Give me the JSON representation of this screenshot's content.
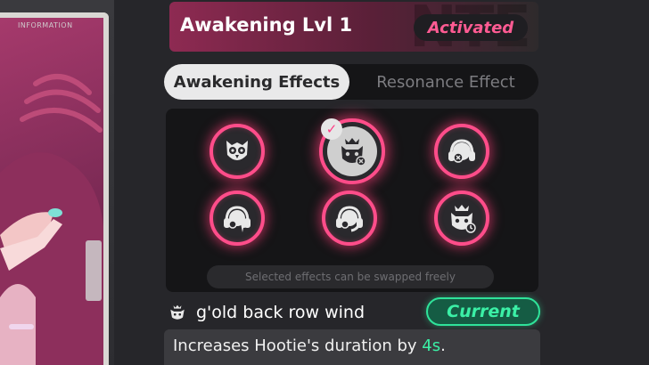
{
  "left_card": {
    "caption": "INFORMATION"
  },
  "header": {
    "title": "Awakening Lvl 1",
    "status": "Activated",
    "watermark": "NTE"
  },
  "tabs": [
    {
      "label": "Awakening Effects",
      "active": true
    },
    {
      "label": "Resonance Effect",
      "active": false
    }
  ],
  "effects": [
    {
      "icon": "owl-icon",
      "selected": false
    },
    {
      "icon": "cat-crown-icon",
      "selected": true
    },
    {
      "icon": "headphones-icon",
      "selected": false
    },
    {
      "icon": "headphones-spiky-icon",
      "selected": false
    },
    {
      "icon": "headphones-arrow-icon",
      "selected": false
    },
    {
      "icon": "cat-clock-icon",
      "selected": false
    }
  ],
  "selection_note": "Selected effects can be swapped freely",
  "current_effect": {
    "icon": "cat-crown-icon",
    "name": "g'old back row wind",
    "badge": "Current"
  },
  "description": {
    "prefix": "Increases Hootie's duration by ",
    "highlight": "4s",
    "suffix": "."
  },
  "colors": {
    "accent_pink": "#ff4d8a",
    "status_pink": "#ff5b93",
    "current_green": "#3bf0a6"
  }
}
